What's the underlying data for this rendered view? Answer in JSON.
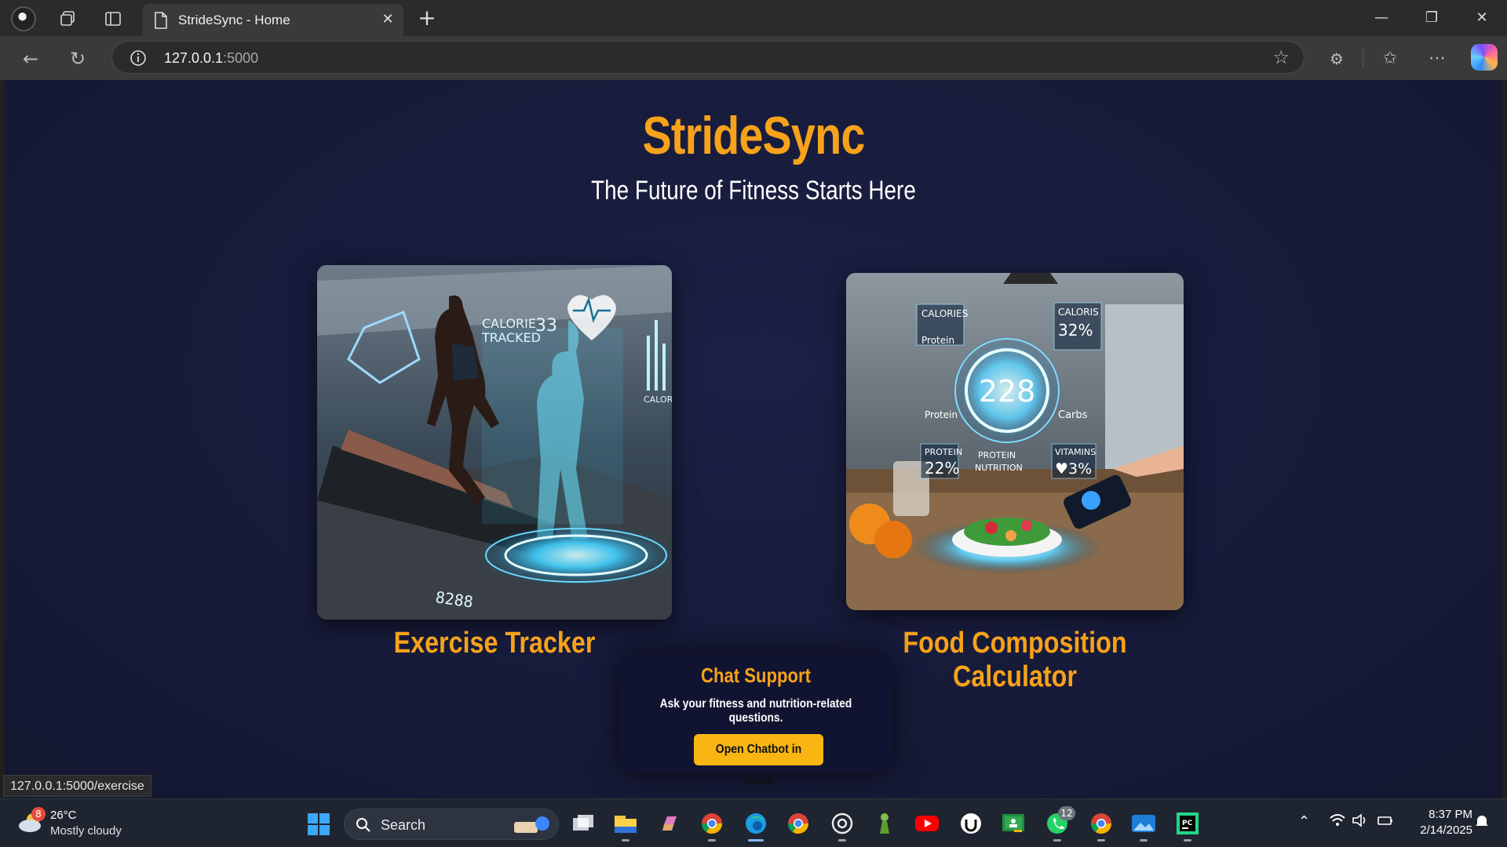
{
  "browser": {
    "tab_title": "StrideSync - Home",
    "url_host": "127.0.0.1",
    "url_port": ":5000",
    "status_url": "127.0.0.1:5000/exercise"
  },
  "page": {
    "brand": "StrideSync",
    "tagline": "The Future of Fitness Starts Here",
    "cards": [
      {
        "title": "Exercise Tracker",
        "image_alt": "Runner on a treadmill with holographic fitness display"
      },
      {
        "title": "Food Composition Calculator",
        "image_alt": "Salad with holographic nutrition readout"
      }
    ],
    "chat": {
      "title": "Chat Support",
      "description": "Ask your fitness and nutrition-related questions.",
      "button": "Open Chatbot in Colab"
    },
    "nutrition_overlay": {
      "center_value": "228",
      "labels": [
        "CALORIES",
        "Protein",
        "CALORIS",
        "32%",
        "Carbs",
        "PROTEIN",
        "22%",
        "PROTEIN NUTRITION",
        "VITAMINS",
        "♥3%"
      ]
    },
    "exercise_overlay": {
      "labels": [
        "CALORIE TRACKED",
        "33",
        "CALORIE",
        "8288"
      ]
    }
  },
  "taskbar": {
    "weather_temp": "26°C",
    "weather_cond": "Mostly cloudy",
    "weather_badge": "8",
    "search_label": "Search",
    "whatsapp_badge": "12",
    "time": "8:37 PM",
    "date": "2/14/2025"
  },
  "colors": {
    "accent": "#f7a21b",
    "button": "#f9b612",
    "page_bg": "#171b3a"
  }
}
